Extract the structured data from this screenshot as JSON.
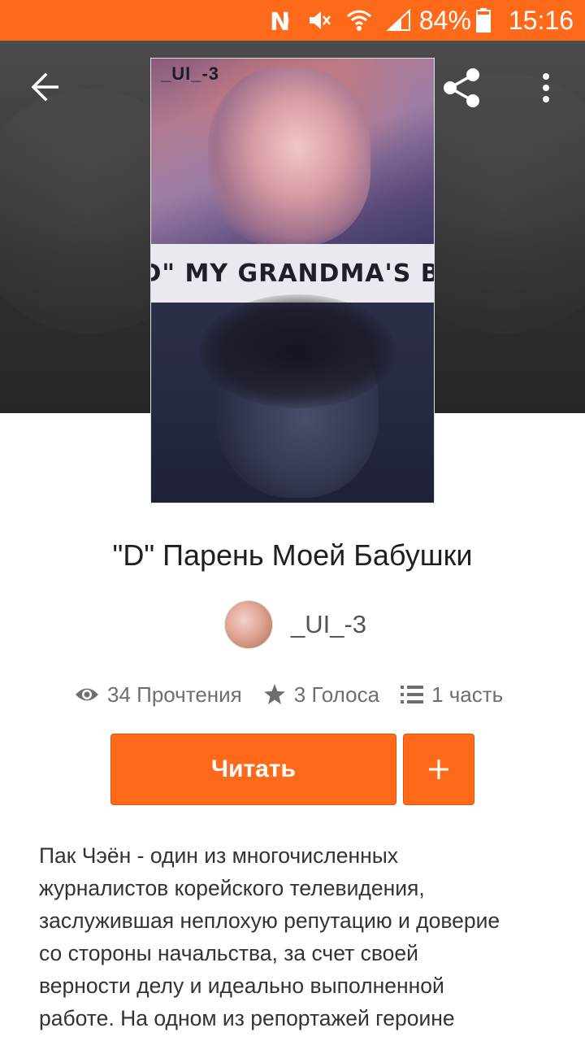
{
  "status_bar": {
    "battery": "84%",
    "time": "15:16"
  },
  "header": {
    "back_icon": "arrow-left-icon",
    "share_icon": "share-icon",
    "more_icon": "more-vertical-icon"
  },
  "cover": {
    "label_top": "_UI_-3",
    "strip_text": "\"D\" MY GRANDMA'S BF"
  },
  "story": {
    "title": "\"D\" Парень Моей Бабушки",
    "author": "_UI_-3"
  },
  "stats": {
    "reads": "34 Прочтения",
    "votes": "3 Голоса",
    "parts": "1 часть"
  },
  "actions": {
    "read_label": "Читать",
    "add_icon": "plus-icon"
  },
  "description": {
    "lines": [
      "Пак Чэён - один из многочисленных",
      "журналистов корейского телевидения,",
      "заслужившая неплохую репутацию и доверие",
      "со стороны начальства, за счет своей",
      "верности делу и идеально выполненной",
      "работе. На одном из репортажей героине"
    ]
  },
  "colors": {
    "accent": "#ff6a1a",
    "header_bg": "#3a3a3a",
    "text": "#333333",
    "muted": "#6e6e6e"
  }
}
